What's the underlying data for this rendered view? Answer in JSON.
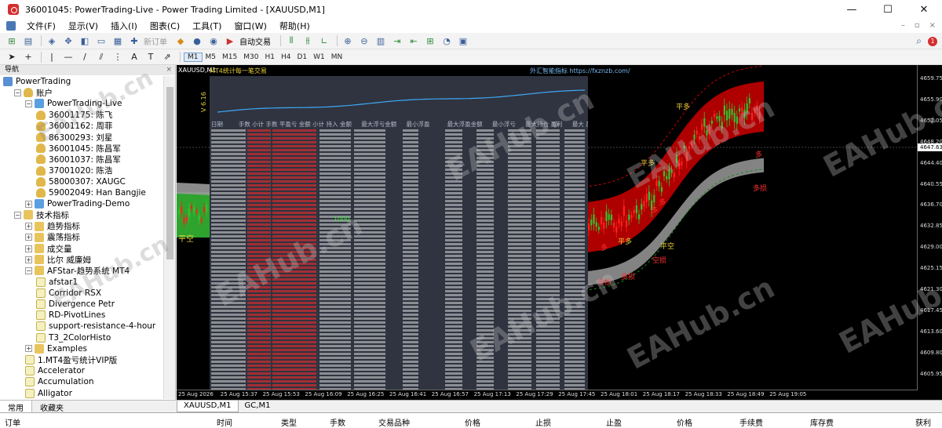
{
  "window": {
    "title": "36001045: PowerTrading-Live - Power Trading Limited - [XAUUSD,M1]",
    "minimize": "—",
    "maximize": "☐",
    "close": "✕"
  },
  "menu": {
    "items": [
      "文件(F)",
      "显示(V)",
      "插入(I)",
      "图表(C)",
      "工具(T)",
      "窗口(W)",
      "帮助(H)"
    ]
  },
  "toolbar": {
    "new_order_label": "新订单",
    "auto_trading_label": "自动交易",
    "periods": [
      "M1",
      "M5",
      "M15",
      "M30",
      "H1",
      "H4",
      "D1",
      "W1",
      "MN"
    ],
    "active_period": "M1",
    "notification_count": "1"
  },
  "navigator": {
    "title": "导航",
    "close": "×",
    "tree": [
      {
        "label": "PowerTrading",
        "level": 0,
        "icon": "monitor-icon",
        "toggle": ""
      },
      {
        "label": "账户",
        "level": 1,
        "icon": "accounts-icon",
        "toggle": "−"
      },
      {
        "label": "PowerTrading-Live",
        "level": 2,
        "icon": "server-icon",
        "toggle": "−"
      },
      {
        "label": "36001175: 陈飞",
        "level": 3,
        "icon": "user-icon",
        "toggle": ""
      },
      {
        "label": "36001162: 周菲",
        "level": 3,
        "icon": "user-icon",
        "toggle": ""
      },
      {
        "label": "86300293: 刘星",
        "level": 3,
        "icon": "user-icon",
        "toggle": ""
      },
      {
        "label": "36001045: 陈昌军",
        "level": 3,
        "icon": "user-icon",
        "toggle": ""
      },
      {
        "label": "36001037: 陈昌军",
        "level": 3,
        "icon": "user-icon",
        "toggle": ""
      },
      {
        "label": "37001020: 陈浩",
        "level": 3,
        "icon": "user-icon",
        "toggle": ""
      },
      {
        "label": "58000307: XAUGC",
        "level": 3,
        "icon": "user-icon",
        "toggle": ""
      },
      {
        "label": "59002049: Han Bangjie",
        "level": 3,
        "icon": "user-icon",
        "toggle": ""
      },
      {
        "label": "PowerTrading-Demo",
        "level": 2,
        "icon": "server-icon",
        "toggle": "+"
      },
      {
        "label": "技术指标",
        "level": 1,
        "icon": "indicators-icon",
        "toggle": "−"
      },
      {
        "label": "趋势指标",
        "level": 2,
        "icon": "folder-icon",
        "toggle": "+"
      },
      {
        "label": "震荡指标",
        "level": 2,
        "icon": "folder-icon",
        "toggle": "+"
      },
      {
        "label": "成交量",
        "level": 2,
        "icon": "folder-icon",
        "toggle": "+"
      },
      {
        "label": "比尔 威廉姆",
        "level": 2,
        "icon": "folder-icon",
        "toggle": "+"
      },
      {
        "label": "AFStar-趋势系统 MT4",
        "level": 2,
        "icon": "folder-icon",
        "toggle": "−"
      },
      {
        "label": "afstar1",
        "level": 3,
        "icon": "indicator-icon",
        "toggle": ""
      },
      {
        "label": "Corridor RSX",
        "level": 3,
        "icon": "indicator-icon",
        "toggle": ""
      },
      {
        "label": "Divergence Petr",
        "level": 3,
        "icon": "indicator-icon",
        "toggle": ""
      },
      {
        "label": "RD-PivotLines",
        "level": 3,
        "icon": "indicator-icon",
        "toggle": ""
      },
      {
        "label": "support-resistance-4-hour",
        "level": 3,
        "icon": "indicator-icon",
        "toggle": ""
      },
      {
        "label": "T3_2ColorHisto",
        "level": 3,
        "icon": "indicator-icon",
        "toggle": ""
      },
      {
        "label": "Examples",
        "level": 2,
        "icon": "folder-icon",
        "toggle": "+"
      },
      {
        "label": "1.MT4盈亏统计VIP版",
        "level": 2,
        "icon": "indicator-icon",
        "toggle": ""
      },
      {
        "label": "Accelerator",
        "level": 2,
        "icon": "indicator-icon",
        "toggle": ""
      },
      {
        "label": "Accumulation",
        "level": 2,
        "icon": "indicator-icon",
        "toggle": ""
      },
      {
        "label": "Alligator",
        "level": 2,
        "icon": "indicator-icon",
        "toggle": ""
      }
    ],
    "tabs": [
      "常用",
      "收藏夹"
    ]
  },
  "chart": {
    "symbol": "XAUUSD,M1",
    "indicator_title": "MT4统计每一笔交易",
    "indicator_link": "外汇智能指标 https://fxznzb.com/",
    "vertical_label": "V 6.16",
    "signal_flat_short": "平空",
    "center_number": "1000",
    "signals": [
      {
        "text": "平多",
        "color": "#f0d038"
      },
      {
        "text": "多",
        "color": "#ff3030"
      },
      {
        "text": "平多",
        "color": "#f0d038"
      },
      {
        "text": "多",
        "color": "#ff3030"
      },
      {
        "text": "多",
        "color": "#ff3030"
      },
      {
        "text": "多损",
        "color": "#ff3030"
      },
      {
        "text": "平多",
        "color": "#f0d038"
      },
      {
        "text": "多损",
        "color": "#ff3030"
      },
      {
        "text": "多损",
        "color": "#ff3030"
      },
      {
        "text": "多",
        "color": "#ff3030"
      },
      {
        "text": "空损",
        "color": "#ff3030"
      },
      {
        "text": "平空",
        "color": "#f0d038"
      }
    ],
    "stats_header": "日期 　　 手数 小计 手数 平盈亏 金额 小计 持入 金额 　 最大浮亏金额 　 最小浮盈 　 　 最大浮盈金额 　 最小浮亏 　 最大持仓 盈利 　 最大 盈亏比",
    "current_price": "4647.63",
    "price_ticks": [
      "4659.75",
      "4655.90",
      "4652.05",
      "4648.20",
      "4644.40",
      "4640.55",
      "4636.70",
      "4632.85",
      "4629.00",
      "4625.15",
      "4621.30",
      "4617.45",
      "4613.60",
      "4609.80",
      "4605.95"
    ],
    "time_ticks": [
      "25 Aug 2026",
      "25 Aug 15:37",
      "25 Aug 15:53",
      "25 Aug 16:09",
      "25 Aug 16:25",
      "25 Aug 16:41",
      "25 Aug 16:57",
      "25 Aug 17:13",
      "25 Aug 17:29",
      "25 Aug 17:45",
      "25 Aug 18:01",
      "25 Aug 18:17",
      "25 Aug 18:33",
      "25 Aug 18:49",
      "25 Aug 19:05"
    ],
    "tabs": [
      "XAUUSD,M1",
      "GC,M1"
    ],
    "colors": {
      "channel_upper": "#cc0000",
      "channel_lower": "#9a9a9a",
      "channel_green": "#33b533",
      "bull": "#2fc42f",
      "bear": "#ff2020",
      "stats_bg": "#2f3440"
    }
  },
  "terminal": {
    "columns": [
      "订单",
      "时间",
      "类型",
      "手数",
      "交易品种",
      "价格",
      "止损",
      "止盈",
      "价格",
      "手续费",
      "库存费",
      "获利"
    ]
  },
  "watermark": "EAHub.cn"
}
